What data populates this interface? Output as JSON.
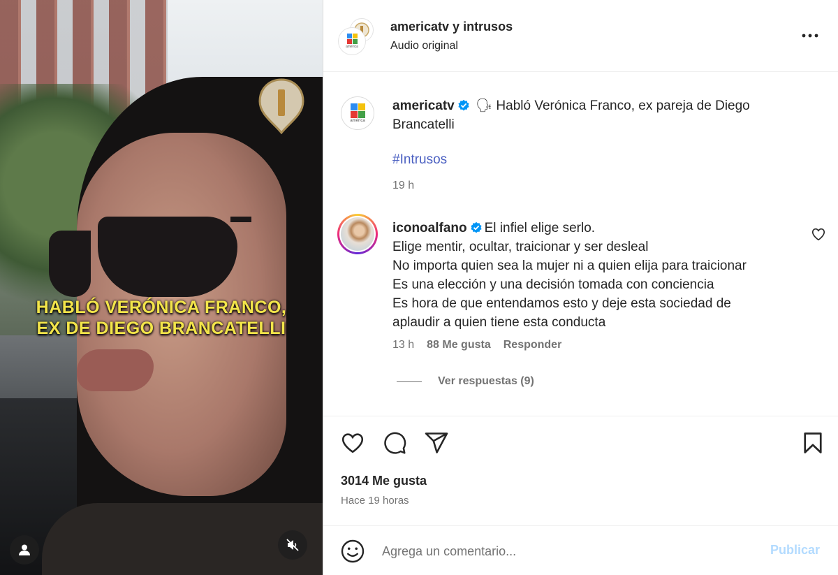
{
  "media": {
    "caption_line1": "HABLÓ VERÓNICA FRANCO,",
    "caption_line2": "EX DE DIEGO BRANCATELLI",
    "user_icon": "user-icon",
    "mute_icon": "muted-speaker-icon"
  },
  "header": {
    "title": "americatv y intrusos",
    "subtitle": "Audio original",
    "more_icon": "more-horizontal-icon"
  },
  "post": {
    "username": "americatv",
    "verified_icon": "verified-badge-icon",
    "text": " 🗣 Habló Verónica Franco, ex pareja de Diego Brancatelli",
    "hashtag": "#Intrusos",
    "time": "19 h"
  },
  "comment": {
    "username": "iconoalfano",
    "lines": [
      "El infiel elige serlo.",
      "Elige mentir, ocultar, traicionar y ser desleal",
      "No importa quien sea la mujer ni a quien elija para traicionar",
      "Es una elección y una decisión tomada con conciencia",
      "Es hora de que entendamos esto y deje esta sociedad de",
      "aplaudir a quien tiene esta conducta"
    ],
    "time": "13 h",
    "likes": "88 Me gusta",
    "reply": "Responder",
    "view_replies": "Ver respuestas (9)"
  },
  "actions": {
    "like_icon": "heart-icon",
    "comment_icon": "comment-bubble-icon",
    "share_icon": "send-icon",
    "save_icon": "bookmark-icon"
  },
  "stats": {
    "likes": "3014 Me gusta",
    "ago": "Hace 19 horas"
  },
  "compose": {
    "emoji_icon": "emoji-icon",
    "placeholder": "Agrega un comentario...",
    "publish": "Publicar"
  },
  "colors": {
    "caption_yellow": "#f3e54a",
    "hashtag_blue": "#4a5fc1",
    "publish_disabled": "#b3dbff",
    "verified_blue": "#0095f6"
  }
}
